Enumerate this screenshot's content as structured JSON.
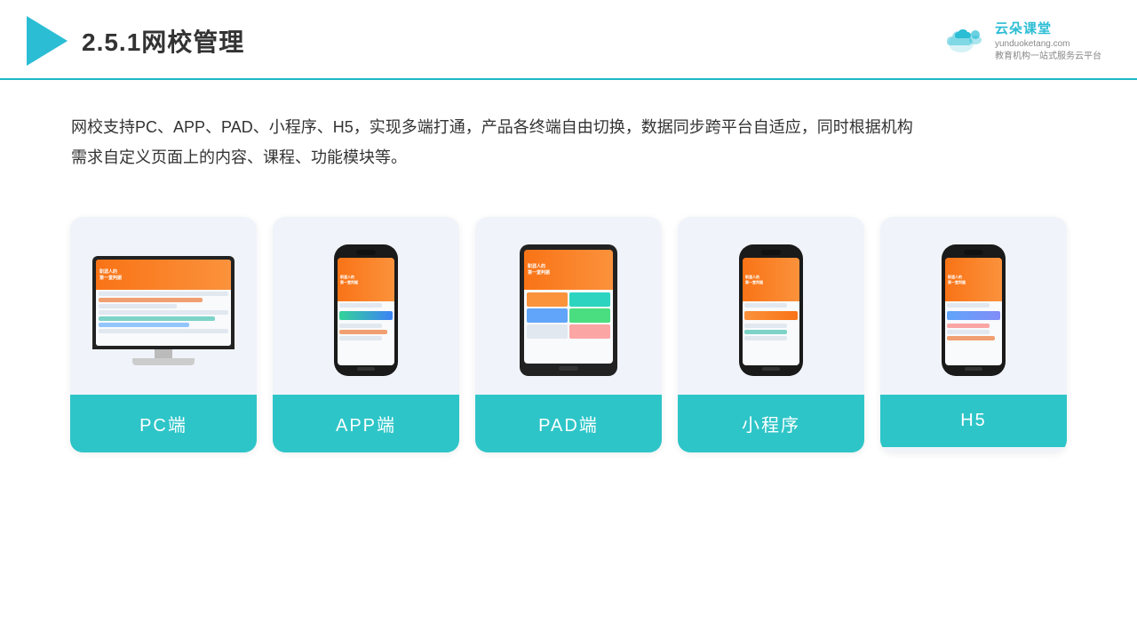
{
  "header": {
    "section_number": "2.5.1",
    "title": "网校管理",
    "brand": {
      "name": "云朵课堂",
      "domain": "yunduoketang.com",
      "slogan": "教育机构一站\n式服务云平台"
    }
  },
  "description": {
    "text": "网校支持PC、APP、PAD、小程序、H5，实现多端打通，产品各终端自由切换，数据同步跨平台自适应，同时根据机构需求自定义页面上的内容、课程、功能模块等。"
  },
  "devices": [
    {
      "id": "pc",
      "label": "PC端",
      "type": "desktop"
    },
    {
      "id": "app",
      "label": "APP端",
      "type": "phone"
    },
    {
      "id": "pad",
      "label": "PAD端",
      "type": "tablet"
    },
    {
      "id": "miniprogram",
      "label": "小程序",
      "type": "phone"
    },
    {
      "id": "h5",
      "label": "H5",
      "type": "phone"
    }
  ],
  "colors": {
    "primary": "#2ec5c8",
    "accent": "#f97316",
    "header_border": "#1db8c8"
  }
}
